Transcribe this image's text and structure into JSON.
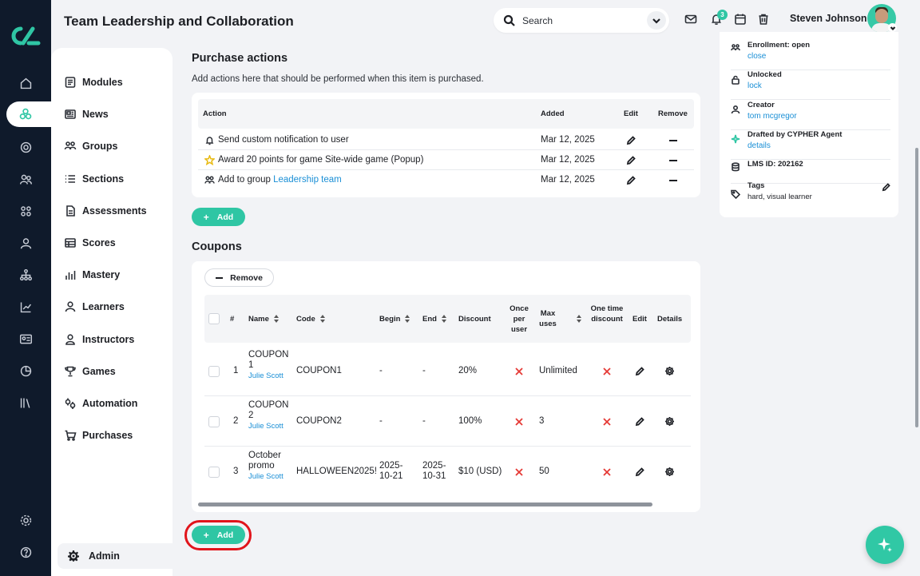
{
  "header": {
    "title": "Team Leadership and Collaboration",
    "search_placeholder": "Search",
    "notification_count": "3",
    "user_name": "Steven Johnson"
  },
  "sidebar": {
    "items": [
      {
        "label": "Modules",
        "icon": "modules-icon"
      },
      {
        "label": "News",
        "icon": "news-icon"
      },
      {
        "label": "Groups",
        "icon": "groups-icon"
      },
      {
        "label": "Sections",
        "icon": "sections-icon"
      },
      {
        "label": "Assessments",
        "icon": "assessments-icon"
      },
      {
        "label": "Scores",
        "icon": "scores-icon"
      },
      {
        "label": "Mastery",
        "icon": "mastery-icon"
      },
      {
        "label": "Learners",
        "icon": "learners-icon"
      },
      {
        "label": "Instructors",
        "icon": "instructors-icon"
      },
      {
        "label": "Games",
        "icon": "games-icon"
      },
      {
        "label": "Automation",
        "icon": "automation-icon"
      },
      {
        "label": "Purchases",
        "icon": "purchases-icon"
      }
    ],
    "admin_label": "Admin"
  },
  "purchase_actions": {
    "title": "Purchase actions",
    "subtitle": "Add actions here that should be performed when this item is purchased.",
    "columns": {
      "action": "Action",
      "added": "Added",
      "edit": "Edit",
      "remove": "Remove"
    },
    "rows": [
      {
        "icon": "bell-icon",
        "text": "Send custom notification to user",
        "link": "",
        "date": "Mar 12, 2025"
      },
      {
        "icon": "star-icon",
        "text": "Award 20 points for game Site-wide game (Popup)",
        "link": "",
        "date": "Mar 12, 2025"
      },
      {
        "icon": "group-icon",
        "text": "Add to group ",
        "link": "Leadership team",
        "date": "Mar 12, 2025"
      }
    ],
    "add_label": "Add"
  },
  "coupons": {
    "title": "Coupons",
    "remove_label": "Remove",
    "columns": {
      "num": "#",
      "name": "Name",
      "code": "Code",
      "begin": "Begin",
      "end": "End",
      "discount": "Discount",
      "once_per_user": "Once per user",
      "max_uses": "Max uses",
      "one_time_discount": "One time discount",
      "edit": "Edit",
      "details": "Details"
    },
    "rows": [
      {
        "num": "1",
        "name": "COUPON 1",
        "author": "Julie Scott",
        "code": "COUPON1",
        "begin": "-",
        "end": "-",
        "discount": "20%",
        "max_uses": "Unlimited"
      },
      {
        "num": "2",
        "name": "COUPON 2",
        "author": "Julie Scott",
        "code": "COUPON2",
        "begin": "-",
        "end": "-",
        "discount": "100%",
        "max_uses": "3"
      },
      {
        "num": "3",
        "name": "October promo",
        "author": "Julie Scott",
        "code": "HALLOWEEN2025!",
        "begin": "2025-10-21",
        "end": "2025-10-31",
        "discount": "$10 (USD)",
        "max_uses": "50"
      }
    ],
    "add_label": "Add"
  },
  "details_panel": {
    "items": [
      {
        "label": "Enrollment: open",
        "value": "close"
      },
      {
        "label": "Unlocked",
        "value": "lock"
      },
      {
        "label": "Creator",
        "value": "tom mcgregor"
      },
      {
        "label": "Drafted by CYPHER Agent",
        "value": "details"
      },
      {
        "label": "LMS ID: 202162",
        "value": ""
      },
      {
        "label": "Tags",
        "value": "hard, visual learner"
      }
    ]
  },
  "colors": {
    "accent": "#2fc6a4",
    "rail": "#0f1a2b",
    "link": "#1a8fd6",
    "danger": "#e53935",
    "highlight": "#e1141b"
  }
}
